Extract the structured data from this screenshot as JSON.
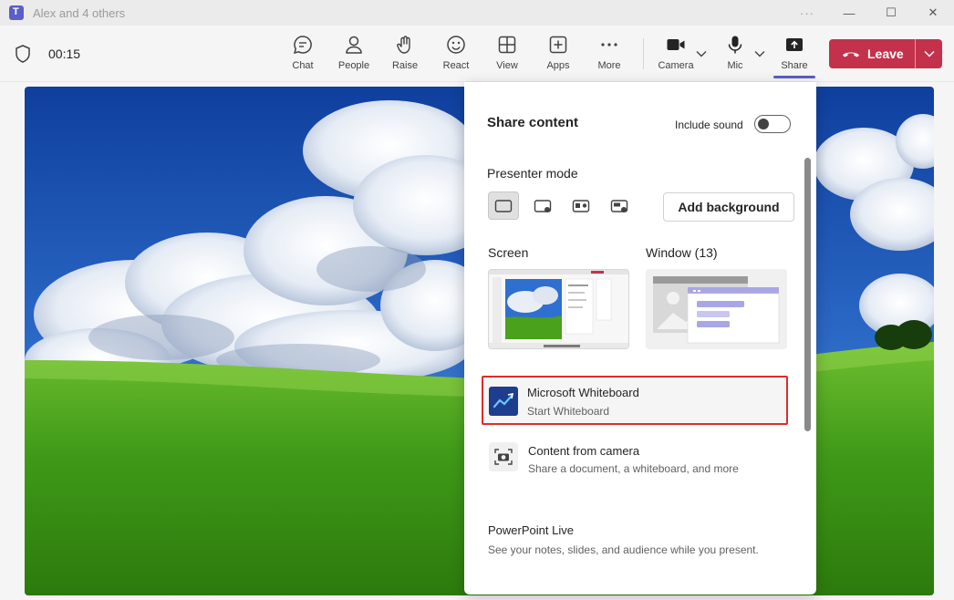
{
  "window": {
    "title": "Alex and 4 others",
    "more_glyph": "···",
    "minimize_glyph": "—",
    "maximize_glyph": "☐",
    "close_glyph": "✕"
  },
  "meeting": {
    "timer": "00:15"
  },
  "toolbar": {
    "items": [
      {
        "label": "Chat",
        "icon": "chat-icon"
      },
      {
        "label": "People",
        "icon": "people-icon"
      },
      {
        "label": "Raise",
        "icon": "raise-hand-icon"
      },
      {
        "label": "React",
        "icon": "react-icon"
      },
      {
        "label": "View",
        "icon": "view-icon"
      },
      {
        "label": "Apps",
        "icon": "apps-icon"
      },
      {
        "label": "More",
        "icon": "more-icon"
      },
      {
        "label": "Camera",
        "icon": "camera-icon"
      },
      {
        "label": "Mic",
        "icon": "mic-icon"
      },
      {
        "label": "Share",
        "icon": "share-icon"
      }
    ],
    "leave_label": "Leave"
  },
  "share_panel": {
    "title": "Share content",
    "include_sound_label": "Include sound",
    "include_sound_on": false,
    "presenter_mode_label": "Presenter mode",
    "add_background_label": "Add background",
    "screen_label": "Screen",
    "window_label": "Window (13)",
    "whiteboard": {
      "title": "Microsoft Whiteboard",
      "subtitle": "Start Whiteboard"
    },
    "camera_content": {
      "title": "Content from camera",
      "subtitle": "Share a document, a whiteboard, and more"
    },
    "powerpoint": {
      "title": "PowerPoint Live",
      "subtitle": "See your notes, slides, and audience while you present."
    }
  },
  "colors": {
    "accent": "#5b5fc7",
    "leave": "#c4314b",
    "highlight_border": "#e02b2b"
  }
}
